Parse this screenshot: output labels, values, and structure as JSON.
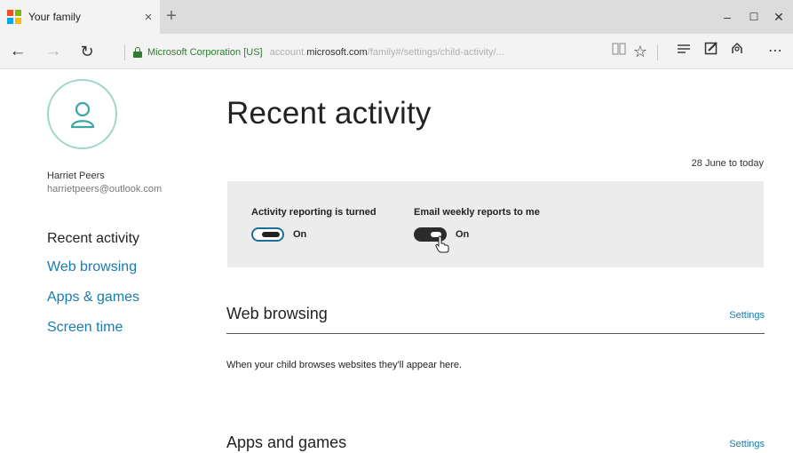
{
  "browser": {
    "tab_title": "Your family",
    "tab_close": "×",
    "new_tab": "+",
    "window_controls": {
      "minimize": "–",
      "maximize": "☐",
      "close": "✕"
    },
    "nav": {
      "back": "←",
      "forward": "→",
      "refresh": "↻"
    },
    "address": {
      "org": "Microsoft Corporation [US]",
      "prefix": "account.",
      "host": "microsoft.com",
      "path": "/family#/settings/child-activity/..."
    },
    "toolbar_icons": [
      "reading-view-icon",
      "favorite-star-icon",
      "hub-icon",
      "web-note-icon",
      "share-icon",
      "more-icon"
    ]
  },
  "colors": {
    "link": "#1a7bb0",
    "accent_ring": "#9fd6cc",
    "panel_bg": "#ececec",
    "secure": "#2e7d32"
  },
  "sidebar": {
    "user_name": "Harriet Peers",
    "user_email": "harrietpeers@outlook.com",
    "items": [
      {
        "label": "Recent activity",
        "active": true
      },
      {
        "label": "Web browsing",
        "active": false
      },
      {
        "label": "Apps & games",
        "active": false
      },
      {
        "label": "Screen time",
        "active": false
      }
    ]
  },
  "main": {
    "title": "Recent activity",
    "date_range": "28 June to today",
    "settings": [
      {
        "label": "Activity reporting is turned",
        "state": "On"
      },
      {
        "label": "Email weekly reports to me",
        "state": "On"
      }
    ],
    "sections": [
      {
        "title": "Web browsing",
        "link": "Settings",
        "empty_message": "When your child browses websites they'll appear here."
      },
      {
        "title": "Apps and games",
        "link": "Settings"
      }
    ]
  }
}
